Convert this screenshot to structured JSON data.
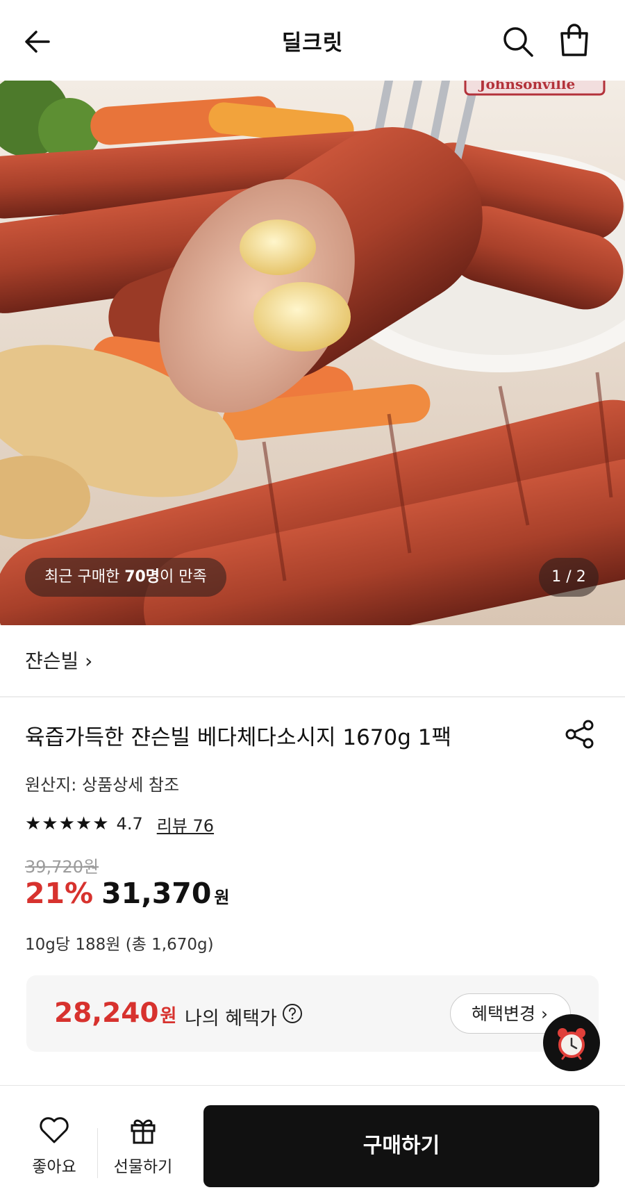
{
  "header": {
    "title": "딜크릿"
  },
  "hero": {
    "satisfaction_prefix": "최근 구매한 ",
    "satisfaction_count": "70명",
    "satisfaction_suffix": "이 만족",
    "pager": "1 / 2",
    "package_text": "Johnsonville"
  },
  "brand": {
    "name": "쟌슨빌 ›"
  },
  "product": {
    "title": "육즙가득한 쟌슨빌 베다체다소시지 1670g 1팩",
    "origin": "원산지: 상품상세 참조",
    "rating_stars": "★★★★★",
    "rating_value": 4.7,
    "rating": "4.7",
    "reviews": "리뷰 76",
    "original_price": "39,720원",
    "discount": "21%",
    "price": "31,370",
    "price_unit": "원",
    "unit_price": "10g당 188원 (총 1,670g)"
  },
  "benefit": {
    "price": "28,240",
    "price_unit": "원",
    "label": "나의 혜택가",
    "change_button": "혜택변경 ›"
  },
  "bottom_bar": {
    "like_label": "좋아요",
    "gift_label": "선물하기",
    "buy_label": "구매하기"
  },
  "colors": {
    "accent_red": "#d7322e",
    "buy_button": "#111111"
  }
}
